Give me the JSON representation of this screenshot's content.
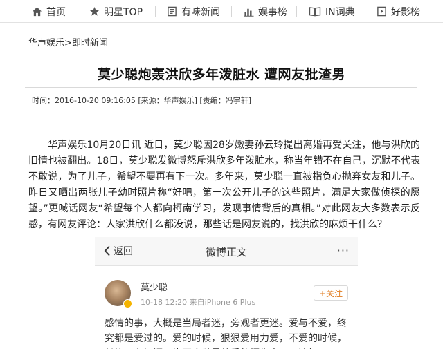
{
  "nav": {
    "items": [
      {
        "label": "首页",
        "icon": "home-icon"
      },
      {
        "label": "明星TOP",
        "icon": "star-icon"
      },
      {
        "label": "有味新闻",
        "icon": "news-icon"
      },
      {
        "label": "娱事榜",
        "icon": "bar-chart-icon"
      },
      {
        "label": "IN词典",
        "icon": "book-icon"
      },
      {
        "label": "好影榜",
        "icon": "film-icon"
      }
    ]
  },
  "breadcrumb": {
    "section": "华声娱乐",
    "separator": ">",
    "subsection": "即时新闻"
  },
  "article": {
    "title": "莫少聪炮轰洪欣多年泼脏水 遭网友批渣男",
    "meta": "时间：2016-10-20 09:16:05 [来源：华声娱乐] [责编：冯宇轩]",
    "paragraph": "华声娱乐10月20日讯 近日，莫少聪因28岁嫩妻孙云玲提出离婚再受关注，他与洪欣的旧情也被翻出。18日，莫少聪发微博怒斥洪欣多年泼脏水，称当年错不在自己，沉默不代表不敢说，为了儿子，希望不要再有下一次。多年来，莫少聪一直被指负心抛弃女友和儿子。昨日又晒出两张儿子幼时照片称“好吧，第一次公开儿子的这些照片，满足大家做侦探的愿望。”更喊话网友“希望每个人都向柯南学习，发现事情背后的真相。”对此网友大多数表示反感，有网友评论：人家洪欣什么都没说，那些话是网友说的，找洪欣的麻烦干什么？"
  },
  "weibo": {
    "back_label": "返回",
    "title": "微博正文",
    "more": "···",
    "user_name": "莫少聪",
    "time_source": "10-18 12:20  来自iPhone 6 Plus",
    "follow_label": "+关注",
    "text": "感情的事，大概是当局者迷，旁观者更迷。爱与不爱，终究都是爱过的。爱的时候，狠狠爱用力爱，不爱的时候，就算无心祝福，也不应做最熟悉的陌生人，无论如"
  },
  "colors": {
    "follow_accent": "#e07b1f",
    "badge": "#f5b400"
  }
}
